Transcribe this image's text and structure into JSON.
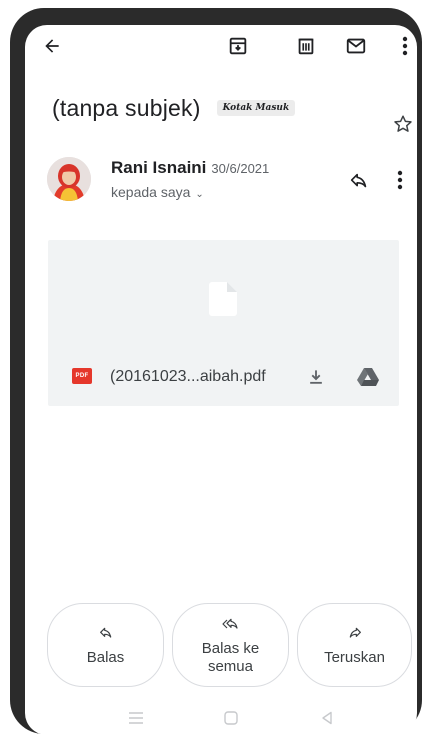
{
  "email": {
    "subject": "(tanpa subjek)",
    "label": "Kotak Masuk",
    "sender_name": "Rani Isnaini",
    "date": "30/6/2021",
    "recipient": "kepada saya"
  },
  "attachment": {
    "file_name": "(20161023...aibah.pdf",
    "badge": "PDF"
  },
  "actions": {
    "reply": "Balas",
    "reply_all_line1": "Balas ke",
    "reply_all_line2": "semua",
    "forward": "Teruskan"
  },
  "icons": {
    "back": "arrow-left-icon",
    "archive": "archive-icon",
    "delete": "trash-icon",
    "mark_unread": "mail-icon",
    "overflow": "more-vert-icon",
    "star": "star-outline-icon",
    "reply": "reply-icon",
    "download": "download-icon",
    "drive": "drive-icon"
  },
  "colors": {
    "pdf_red": "#e5372b",
    "attachment_bg": "#f1f3f4",
    "text_primary": "#202124",
    "text_secondary": "#5f6368"
  }
}
